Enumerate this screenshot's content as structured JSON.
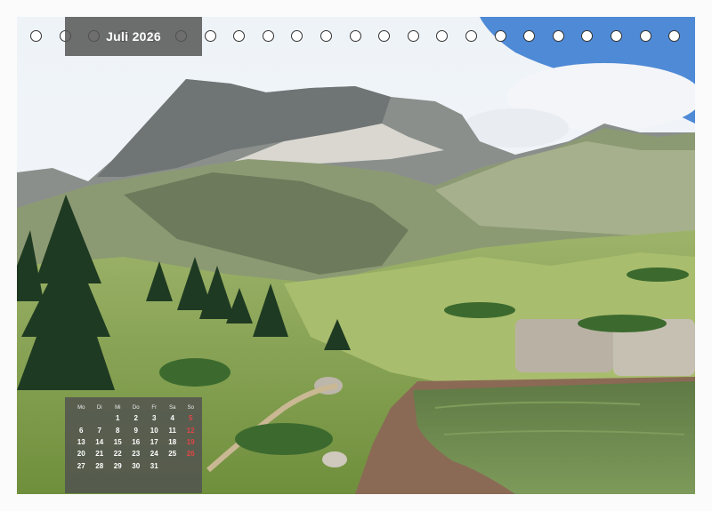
{
  "calendar": {
    "month_title": "Juli 2026",
    "weekday_headers": [
      "Mo",
      "Di",
      "Mi",
      "Do",
      "Fr",
      "Sa",
      "So"
    ],
    "weeks": [
      [
        "",
        "",
        "1",
        "2",
        "3",
        "4",
        "5"
      ],
      [
        "6",
        "7",
        "8",
        "9",
        "10",
        "11",
        "12"
      ],
      [
        "13",
        "14",
        "15",
        "16",
        "17",
        "18",
        "19"
      ],
      [
        "20",
        "21",
        "22",
        "23",
        "24",
        "25",
        "26"
      ],
      [
        "27",
        "28",
        "29",
        "30",
        "31",
        "",
        ""
      ]
    ],
    "binding_hole_count": 23
  },
  "colors": {
    "sunday": "#e04545",
    "overlay": "#555555",
    "sky": "#8fb0d6",
    "lake": "#6f8a4e"
  }
}
